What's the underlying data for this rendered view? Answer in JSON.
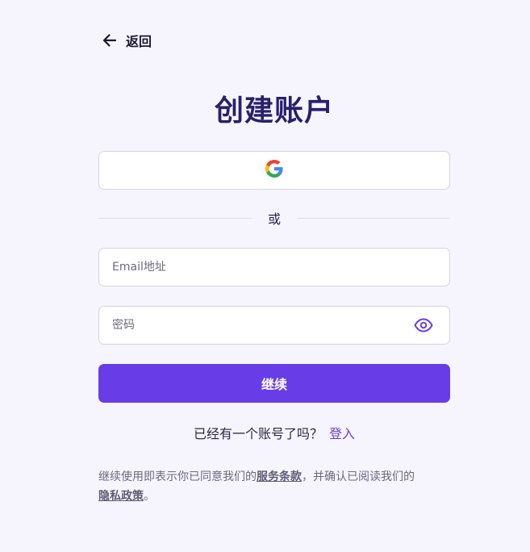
{
  "back": {
    "label": "返回",
    "icon": "arrow-left-icon"
  },
  "title": "创建账户",
  "google_button": {
    "icon": "google-icon"
  },
  "divider": {
    "label": "或"
  },
  "email": {
    "placeholder": "Email地址",
    "value": ""
  },
  "password": {
    "placeholder": "密码",
    "value": "",
    "icon": "eye-icon"
  },
  "continue_label": "继续",
  "signin": {
    "prompt": "已经有一个账号了吗？",
    "link": "登入"
  },
  "terms": {
    "prefix": "继续使用即表示你已同意我们的",
    "tos_link": "服务条款",
    "middle": "，并确认已阅读我们的",
    "privacy_link": "隐私政策",
    "suffix": "。"
  },
  "colors": {
    "background": "#f6f5fd",
    "accent": "#683ce6",
    "title": "#2a1f6b",
    "link": "#6a3ee0"
  }
}
